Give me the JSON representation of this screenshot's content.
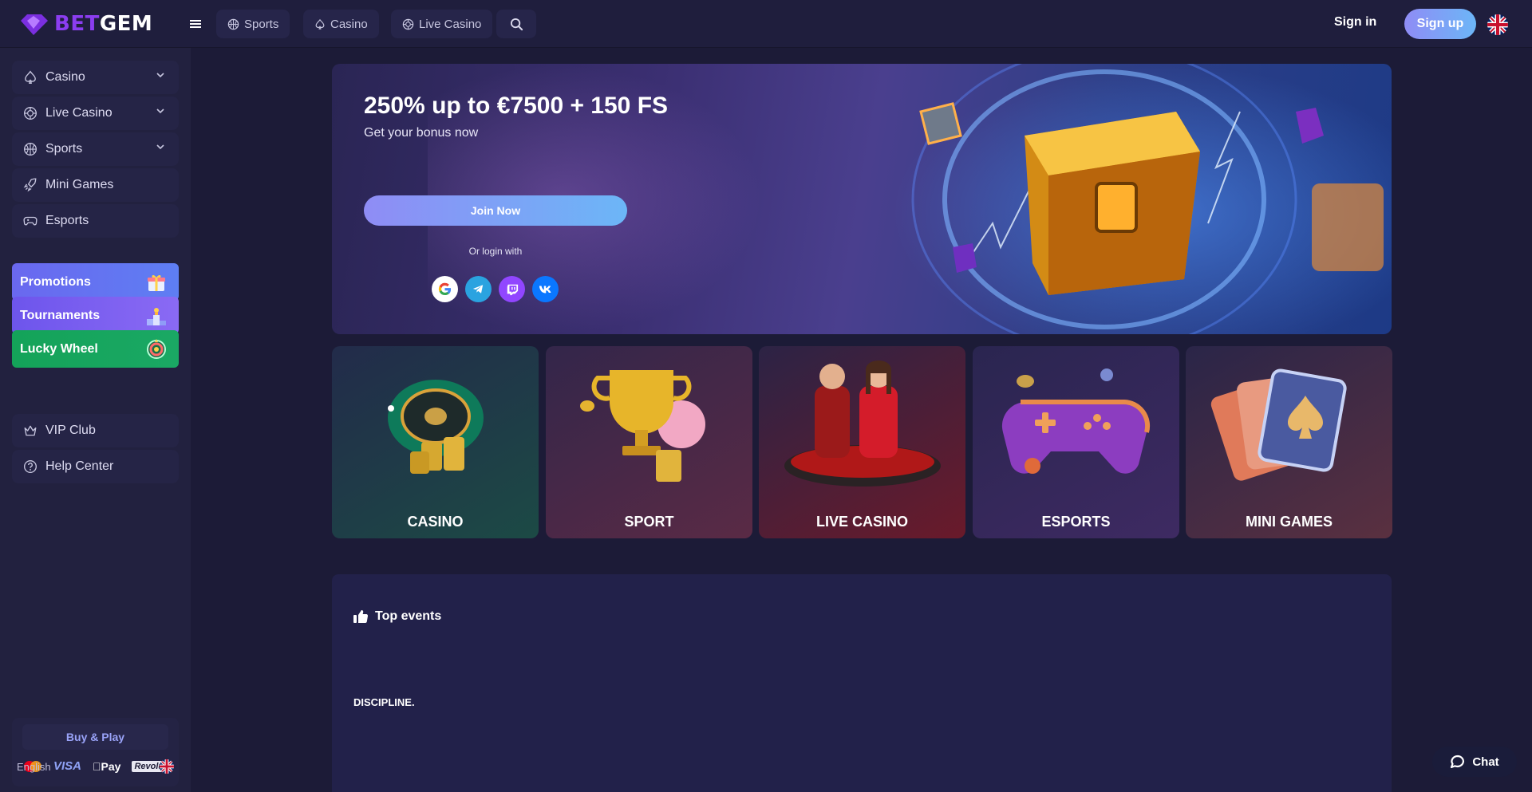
{
  "brand": {
    "part1": "BET",
    "part2": "GEM"
  },
  "header": {
    "nav": [
      {
        "label": "Sports",
        "icon": "basketball-icon"
      },
      {
        "label": "Casino",
        "icon": "spade-icon"
      },
      {
        "label": "Live Casino",
        "icon": "chip-icon"
      }
    ],
    "signin": "Sign in",
    "signup": "Sign up"
  },
  "sidebar": {
    "menu": [
      {
        "label": "Casino",
        "icon": "spade-icon"
      },
      {
        "label": "Live Casino",
        "icon": "chip-icon"
      },
      {
        "label": "Sports",
        "icon": "basketball-icon"
      },
      {
        "label": "Mini Games",
        "icon": "rocket-icon"
      },
      {
        "label": "Esports",
        "icon": "gamepad-icon"
      }
    ],
    "promos": [
      {
        "label": "Promotions",
        "color": "#6a6cf0"
      },
      {
        "label": "Tournaments",
        "color": "#7a5bf0"
      },
      {
        "label": "Lucky Wheel",
        "color": "#22a25b"
      }
    ],
    "extra": [
      {
        "label": "VIP Club",
        "icon": "crown-icon"
      },
      {
        "label": "Help Center",
        "icon": "help-icon"
      }
    ],
    "buy_play": "Buy & Play",
    "payments": [
      "Mastercard",
      "VISA",
      "Pay",
      "Revolut"
    ],
    "language": "English"
  },
  "hero": {
    "title": "250% up to €7500 + 150 FS",
    "subtitle": "Get your bonus now",
    "join": "Join Now",
    "or_login": "Or login with"
  },
  "categories": [
    {
      "label": "CASINO",
      "color": "#1c4a45"
    },
    {
      "label": "SPORT",
      "color": "#5a2a45"
    },
    {
      "label": "LIVE CASINO",
      "color": "#6a1a2a"
    },
    {
      "label": "ESPORTS",
      "color": "#3e2a62"
    },
    {
      "label": "MINI GAMES",
      "color": "#5a3040"
    }
  ],
  "events": {
    "title": "Top events",
    "discipline": "DISCIPLINE."
  },
  "chat": "Chat"
}
